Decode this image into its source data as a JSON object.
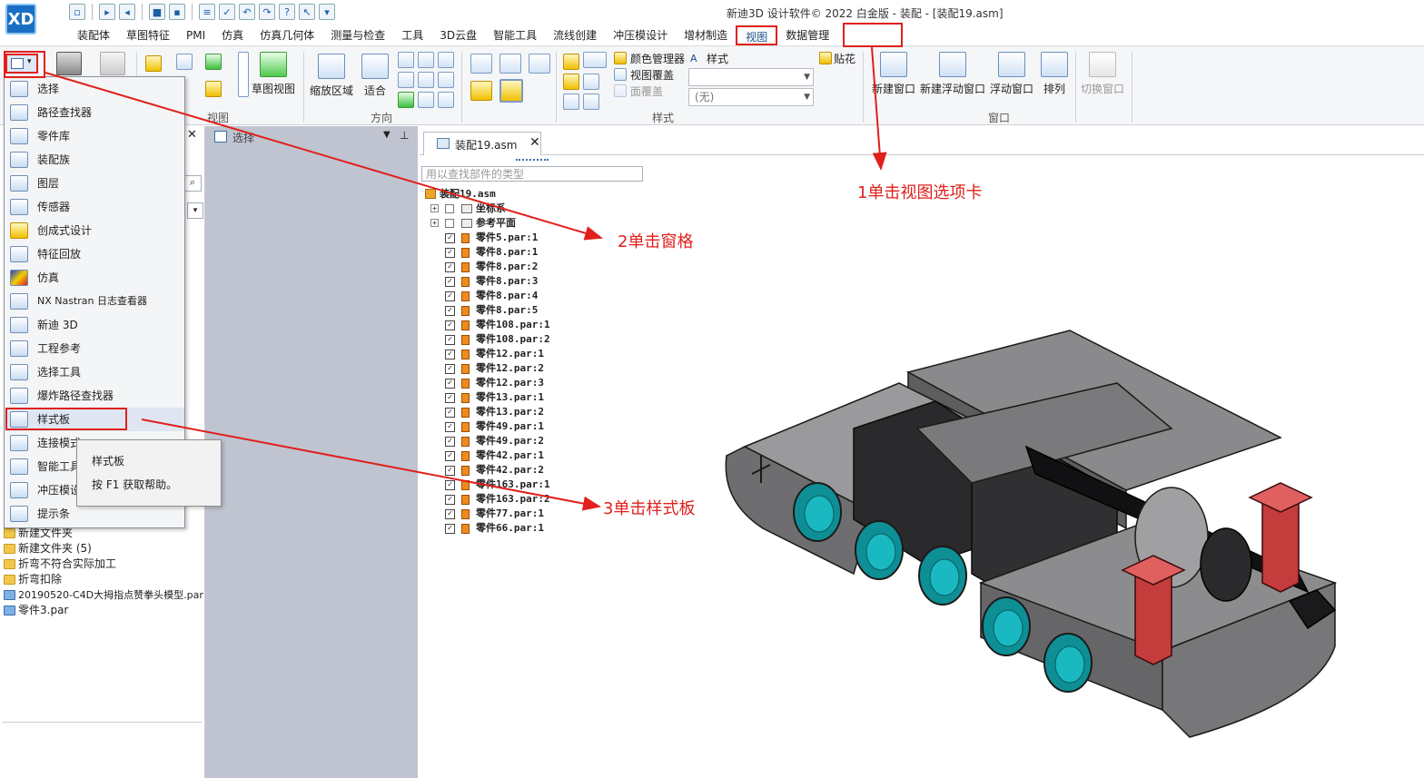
{
  "window": {
    "title": "新迪3D 设计软件© 2022 白金版 - 装配 - [装配19.asm]",
    "logo": "XD"
  },
  "ribbon_tabs": [
    {
      "label": "装配体"
    },
    {
      "label": "草图特征"
    },
    {
      "label": "PMI"
    },
    {
      "label": "仿真"
    },
    {
      "label": "仿真几何体"
    },
    {
      "label": "测量与检查"
    },
    {
      "label": "工具"
    },
    {
      "label": "3D云盘"
    },
    {
      "label": "智能工具"
    },
    {
      "label": "流线创建"
    },
    {
      "label": "冲压模设计"
    },
    {
      "label": "增材制造"
    },
    {
      "label": "视图"
    },
    {
      "label": "数据管理"
    }
  ],
  "ribbon": {
    "view_group_label": "视图",
    "sketch_view": "草图视图",
    "direction_group_label": "方向",
    "zoom_area": "缩放区域",
    "fit": "适合",
    "style_group_label": "样式",
    "color_manager": "颜色管理器",
    "view_overlay": "视图覆盖",
    "face_overlay": "面覆盖",
    "style_label": "样式",
    "style_none": "(无)",
    "decal": "贴花",
    "new_window": "新建窗口",
    "new_float_window": "新建浮动窗口",
    "float_window": "浮动窗口",
    "arrange": "排列",
    "switch_window": "切换窗口",
    "window_group_label": "窗口"
  },
  "panes_menu": [
    {
      "label": "选择"
    },
    {
      "label": "路径查找器"
    },
    {
      "label": "零件库"
    },
    {
      "label": "装配族"
    },
    {
      "label": "图层"
    },
    {
      "label": "传感器"
    },
    {
      "label": "创成式设计"
    },
    {
      "label": "特征回放"
    },
    {
      "label": "仿真"
    },
    {
      "label": "NX Nastran 日志查看器"
    },
    {
      "label": "新迪 3D"
    },
    {
      "label": "工程参考"
    },
    {
      "label": "选择工具"
    },
    {
      "label": "爆炸路径查找器"
    },
    {
      "label": "样式板"
    },
    {
      "label": "连接模式"
    },
    {
      "label": "智能工具"
    },
    {
      "label": "冲压模设计"
    },
    {
      "label": "提示条"
    }
  ],
  "tooltip": {
    "title": "样式板",
    "help": "按 F1 获取帮助。"
  },
  "left_panel": {
    "select_pane_label": "选择",
    "tree_items": [
      {
        "label": "新建文件夹"
      },
      {
        "label": "新建文件夹 (5)"
      },
      {
        "label": "折弯不符合实际加工"
      },
      {
        "label": "折弯扣除"
      },
      {
        "label": "20190520-C4D大拇指点赞拳头模型.par"
      },
      {
        "label": "零件3.par"
      }
    ]
  },
  "document": {
    "tab_label": "装配19.asm",
    "search_placeholder": "用以查找部件的类型",
    "root": "装配19.asm",
    "groups": [
      {
        "label": "坐标系"
      },
      {
        "label": "参考平面"
      }
    ],
    "parts": [
      {
        "label": "零件5.par:1",
        "checked": true
      },
      {
        "label": "零件8.par:1",
        "checked": true
      },
      {
        "label": "零件8.par:2",
        "checked": true
      },
      {
        "label": "零件8.par:3",
        "checked": true
      },
      {
        "label": "零件8.par:4",
        "checked": true
      },
      {
        "label": "零件8.par:5",
        "checked": true
      },
      {
        "label": "零件108.par:1",
        "checked": true
      },
      {
        "label": "零件108.par:2",
        "checked": true
      },
      {
        "label": "零件12.par:1",
        "checked": true
      },
      {
        "label": "零件12.par:2",
        "checked": true
      },
      {
        "label": "零件12.par:3",
        "checked": true
      },
      {
        "label": "零件13.par:1",
        "checked": true
      },
      {
        "label": "零件13.par:2",
        "checked": true
      },
      {
        "label": "零件49.par:1",
        "checked": true
      },
      {
        "label": "零件49.par:2",
        "checked": true
      },
      {
        "label": "零件42.par:1",
        "checked": true
      },
      {
        "label": "零件42.par:2",
        "checked": true
      },
      {
        "label": "零件163.par:1",
        "checked": true
      },
      {
        "label": "零件163.par:2",
        "checked": true
      },
      {
        "label": "零件77.par:1",
        "checked": true
      },
      {
        "label": "零件66.par:1",
        "checked": true
      }
    ]
  },
  "annotations": {
    "step1": "1单击视图选项卡",
    "step2": "2单击窗格",
    "step3": "3单击样式板",
    "color": "#e0201c"
  },
  "colors": {
    "accent": "#1a4f8a",
    "annotation": "#e0201c",
    "part_body": "#6e6e70",
    "part_dark": "#1e1e20",
    "part_cyan": "#1ab8c0",
    "part_red": "#c43c3c"
  }
}
